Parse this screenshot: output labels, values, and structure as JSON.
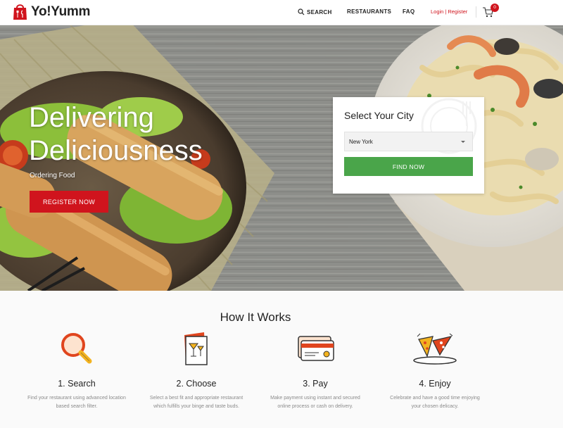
{
  "header": {
    "logo_text": "Yo!Yumm",
    "nav": {
      "search": "SEARCH",
      "restaurants": "RESTAURANTS",
      "faq": "FAQ",
      "login": "Login",
      "separator": "|",
      "register": "Register"
    },
    "cart_count": "0"
  },
  "hero": {
    "title_line1": "Delivering",
    "title_line2": "Deliciousness",
    "subtitle": "Ordering Food",
    "register_button": "REGISTER NOW",
    "city_box": {
      "title": "Select Your City",
      "selected_city": "New York",
      "find_button": "FIND NOW"
    }
  },
  "how_it_works": {
    "title": "How It Works",
    "steps": [
      {
        "title": "1. Search",
        "desc_line1": "Find your restaurant using advanced location",
        "desc_line2": "based search filter.",
        "icon": "magnifier-icon"
      },
      {
        "title": "2. Choose",
        "desc_line1": "Select a best fit and appropriate restaurant",
        "desc_line2": "which fulfills your binge and taste buds.",
        "icon": "menu-cocktail-icon"
      },
      {
        "title": "3. Pay",
        "desc_line1": "Make payment using instant and secured",
        "desc_line2": "online process or cash on delivery.",
        "icon": "credit-card-icon"
      },
      {
        "title": "4. Enjoy",
        "desc_line1": "Celebrate and have a good time enjoying",
        "desc_line2": "your chosen delicacy.",
        "icon": "pizza-plate-icon"
      }
    ]
  },
  "colors": {
    "brand_red": "#d0141d",
    "find_green": "#4aa54a",
    "icon_orange": "#f0a030"
  }
}
